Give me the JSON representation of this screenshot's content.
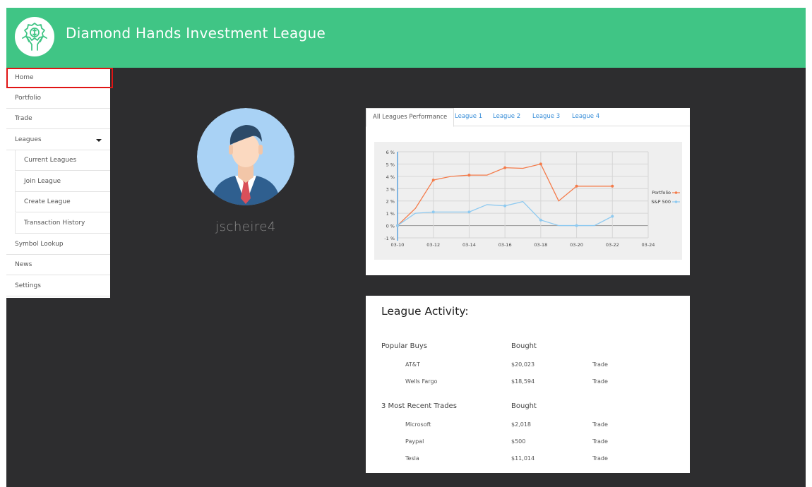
{
  "header": {
    "title": "Diamond Hands Investment League",
    "logo_icon": "money-hands-icon"
  },
  "sidebar": {
    "items": [
      {
        "label": "Home"
      },
      {
        "label": "Portfolio"
      },
      {
        "label": "Trade"
      },
      {
        "label": "Leagues"
      },
      {
        "label": "Current Leagues"
      },
      {
        "label": "Join League"
      },
      {
        "label": "Create League"
      },
      {
        "label": "Transaction History"
      },
      {
        "label": "Symbol Lookup"
      },
      {
        "label": "News"
      },
      {
        "label": "Settings"
      }
    ]
  },
  "profile": {
    "username": "jscheire4",
    "avatar_icon": "businessman-avatar-icon"
  },
  "chart_tabs": [
    "All Leagues Performance",
    "League 1",
    "League 2",
    "League 3",
    "League 4"
  ],
  "chart_data": {
    "type": "line",
    "x": [
      "03-10",
      "03-11",
      "03-12",
      "03-13",
      "03-14",
      "03-15",
      "03-16",
      "03-17",
      "03-18",
      "03-19",
      "03-20",
      "03-21",
      "03-22"
    ],
    "x_ticks": [
      "03-10",
      "03-12",
      "03-14",
      "03-16",
      "03-18",
      "03-20",
      "03-22",
      "03-24"
    ],
    "y_ticks": [
      "6 %",
      "5 %",
      "4 %",
      "3 %",
      "2 %",
      "1 %",
      "0 %",
      "-1 %"
    ],
    "ylim": [
      -1,
      6
    ],
    "series": [
      {
        "name": "Portfolio",
        "color": "#f47b4a",
        "values": [
          0,
          1.4,
          3.7,
          4.0,
          4.1,
          4.1,
          4.7,
          4.65,
          5.0,
          2.0,
          3.2,
          3.2,
          3.2
        ]
      },
      {
        "name": "S&P 500",
        "color": "#8fcaf0",
        "values": [
          0,
          1.0,
          1.1,
          1.1,
          1.1,
          1.7,
          1.6,
          1.95,
          0.45,
          0,
          0,
          0,
          0.75
        ]
      }
    ],
    "legend_position": "right",
    "grid": true
  },
  "activity": {
    "title": "League Activity:",
    "popular": {
      "heading": "Popular Buys",
      "col": "Bought",
      "rows": [
        {
          "name": "AT&T",
          "amount": "$20,023",
          "action": "Trade"
        },
        {
          "name": "Wells Fargo",
          "amount": "$18,594",
          "action": "Trade"
        }
      ]
    },
    "recent": {
      "heading": "3 Most Recent Trades",
      "col": "Bought",
      "rows": [
        {
          "name": "Microsoft",
          "amount": "$2,018",
          "action": "Trade"
        },
        {
          "name": "Paypal",
          "amount": "$500",
          "action": "Trade"
        },
        {
          "name": "Tesla",
          "amount": "$11,014",
          "action": "Trade"
        }
      ]
    }
  }
}
